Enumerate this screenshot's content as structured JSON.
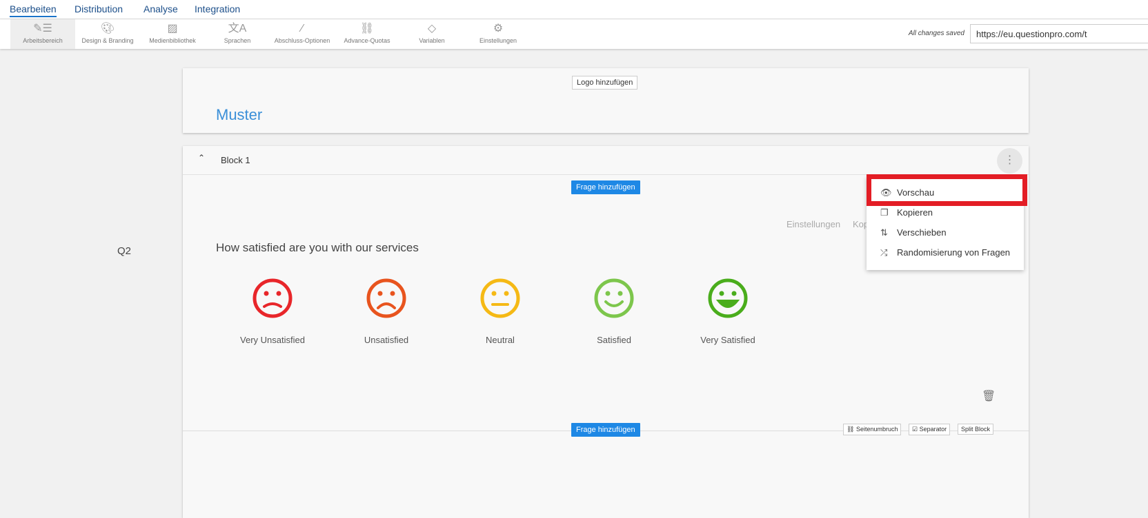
{
  "topnav": {
    "items": [
      "Bearbeiten",
      "Distribution",
      "Analyse",
      "Integration"
    ]
  },
  "toolbar": {
    "items": [
      {
        "label": "Arbeitsbereich",
        "icon": "pen-list-icon"
      },
      {
        "label": "Design & Branding",
        "icon": "palette-icon"
      },
      {
        "label": "Medienbibliothek",
        "icon": "image-icon"
      },
      {
        "label": "Sprachen",
        "icon": "translate-icon"
      },
      {
        "label": "Abschluss-Optionen",
        "icon": "magic-wand-icon"
      },
      {
        "label": "Advance-Quotas",
        "icon": "link-icon"
      },
      {
        "label": "Variablen",
        "icon": "tag-icon"
      },
      {
        "label": "Einstellungen",
        "icon": "gear-icon"
      }
    ],
    "saved": "All changes saved",
    "url": "https://eu.questionpro.com/t"
  },
  "header_card": {
    "logo_button": "Logo hinzufügen",
    "title": "Muster"
  },
  "block": {
    "title": "Block 1",
    "add_question": "Frage hinzufügen",
    "question_number": "Q2",
    "question_text": "How satisfied are you with our services",
    "question_actions": [
      "Einstellungen",
      "Kop"
    ],
    "options": [
      {
        "label": "Very Unsatisfied",
        "color": "#e8262a"
      },
      {
        "label": "Unsatisfied",
        "color": "#e8541e"
      },
      {
        "label": "Neutral",
        "color": "#f5b915"
      },
      {
        "label": "Satisfied",
        "color": "#7dc64c"
      },
      {
        "label": "Very Satisfied",
        "color": "#4aad1c"
      }
    ],
    "bottom": {
      "add_question": "Frage hinzufügen",
      "page_break": "Seitenumbruch",
      "separator": "Separator",
      "split": "Split Block"
    }
  },
  "menu": {
    "items": [
      "Vorschau",
      "Kopieren",
      "Verschieben",
      "Randomisierung von Fragen"
    ]
  }
}
